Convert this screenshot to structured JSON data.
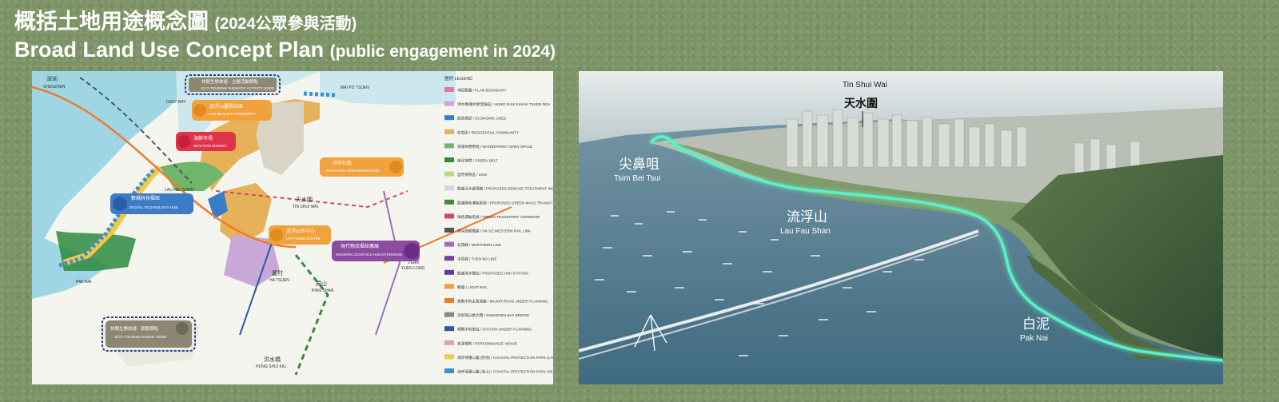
{
  "header": {
    "title_zh": "概括土地用途概念圖",
    "title_zh_sub": "(2024公眾參與活動)",
    "title_en": "Broad Land Use Concept Plan",
    "title_en_sub": "(public engagement in 2024)"
  },
  "map": {
    "places": {
      "shenzhen_zh": "深圳",
      "shenzhen_en": "SHENZHEN",
      "lau_fau_shan": "LAU FAU SHAN",
      "deep_bay": "DEEP BAY",
      "pak_nai": "PAK NAI",
      "tin_shui_wai_zh": "天水圍",
      "tin_shui_wai_en": "TIN SHUI WAI",
      "ping_shan_zh": "屏山",
      "ping_shan_en": "PING SHAN",
      "ha_tsuen_zh": "厦村",
      "ha_tsuen_en": "HA TSUEN",
      "hung_shui_kiu_zh": "洪水橋",
      "hung_shui_kiu_en": "HUNG SHUI KIU",
      "mai_po_tsuen": "MAI PO TSUEN",
      "yuen_long_zh": "元朗",
      "yuen_long_en": "YUEN LONG"
    },
    "callouts": [
      {
        "zh": "休閒生態旅遊 - 主題活動節點",
        "en": "ECO-TOURISM THEMATIC ACTIVITY NODE",
        "color": "#8c8673"
      },
      {
        "zh": "流浮山優質社區",
        "en": "LFS QUALITY COMMUNITY",
        "color": "#f2a23c"
      },
      {
        "zh": "海鮮市場",
        "en": "SEAFOOD MARKET",
        "color": "#e0334a"
      },
      {
        "zh": "河岸社區",
        "en": "RIVERSIDE NEIGHBOURHOOD",
        "color": "#f2a23c"
      },
      {
        "zh": "數碼科技樞紐",
        "en": "DIGITAL TECHNOLOGY HUB",
        "color": "#3c7cc7"
      },
      {
        "zh": "流浮山市中心",
        "en": "LFS TOWN CENTRE",
        "color": "#f2a23c"
      },
      {
        "zh": "現代物流樞紐擴展",
        "en": "MODERN LOGISTICS HUB EXTENSION",
        "color": "#8c4aa0"
      },
      {
        "zh": "休閒生態旅遊 - 景觀節點",
        "en": "ECO-TOURISM SCENIC NODE",
        "color": "#8c8673"
      }
    ],
    "legend_title": "圖例 LEGEND",
    "legend_items": [
      {
        "label": "項目範圍 / PLAN BOUNDARY",
        "color": "#e07a9a"
      },
      {
        "label": "洪水橋/厦村新發展區 / HUNG SHUI KIU/HA TSUEN NDA",
        "color": "#c7a8d8"
      },
      {
        "label": "經濟用途 / ECONOMIC USES",
        "color": "#3c7cc7"
      },
      {
        "label": "住宅區 / RESIDENTIAL COMMUNITY",
        "color": "#e5b25a"
      },
      {
        "label": "海濱休憩用地 / WATERFRONT OPEN SPACE",
        "color": "#6fb56a"
      },
      {
        "label": "綠化地帶 / GREEN BELT",
        "color": "#2d8a3e"
      },
      {
        "label": "自然保育區 / SSSI",
        "color": "#b9d98a"
      },
      {
        "label": "擬議污水處理廠 / PROPOSED SEWAGE TREATMENT WORKS",
        "color": "#c9d8e8"
      },
      {
        "label": "擬議綠色運輸系統 / PROPOSED GREEN MASS TRANSIT",
        "color": "#3a8a3a"
      },
      {
        "label": "綠色運輸走廊 / GREEN TRANSPORT CORRIDOR",
        "color": "#d4456b"
      },
      {
        "label": "港深西部鐵路 / HK-SZ WESTERN RAIL LINK",
        "color": "#555555"
      },
      {
        "label": "北環線 / NORTHERN LINK",
        "color": "#9c6fc0"
      },
      {
        "label": "屯馬線 / TUEN MA LINE",
        "color": "#7b3fa0"
      },
      {
        "label": "擬議洪水橋站 / PROPOSED HSK STATION",
        "color": "#5b3fa0"
      },
      {
        "label": "輕鐵 / LIGHT RAIL",
        "color": "#e6a23c"
      },
      {
        "label": "規劃中的主要道路 / MAJOR ROAD UNDER PLANNING",
        "color": "#f07a2c"
      },
      {
        "label": "深圳灣公路大橋 / SHENZHEN BAY BRIDGE",
        "color": "#888888"
      },
      {
        "label": "規劃中的車站 / STATION UNDER PLANNING",
        "color": "#2c5aa0"
      },
      {
        "label": "表演場地 / PERFORMANCE VENUE",
        "color": "#d9a0c0"
      },
      {
        "label": "海岸保護公園 (陸地) / COASTAL PROTECTION PARK (LANDSIDE)",
        "color": "#f5c842"
      },
      {
        "label": "海岸保護公園 (海上) / COASTAL PROTECTION PARK (SEASIDE)",
        "color": "#3c8fd4"
      }
    ]
  },
  "aerial": {
    "labels": {
      "tin_shui_wai_en": "Tin Shui Wai",
      "tin_shui_wai_zh": "天水圍",
      "tsim_bei_tsui_zh": "尖鼻咀",
      "tsim_bei_tsui_en": "Tsim Bei Tsui",
      "lau_fau_shan_zh": "流浮山",
      "lau_fau_shan_en": "Lau Fau Shan",
      "pak_nai_zh": "白泥",
      "pak_nai_en": "Pak Nai"
    },
    "coastline_color": "#5cf0c4"
  }
}
